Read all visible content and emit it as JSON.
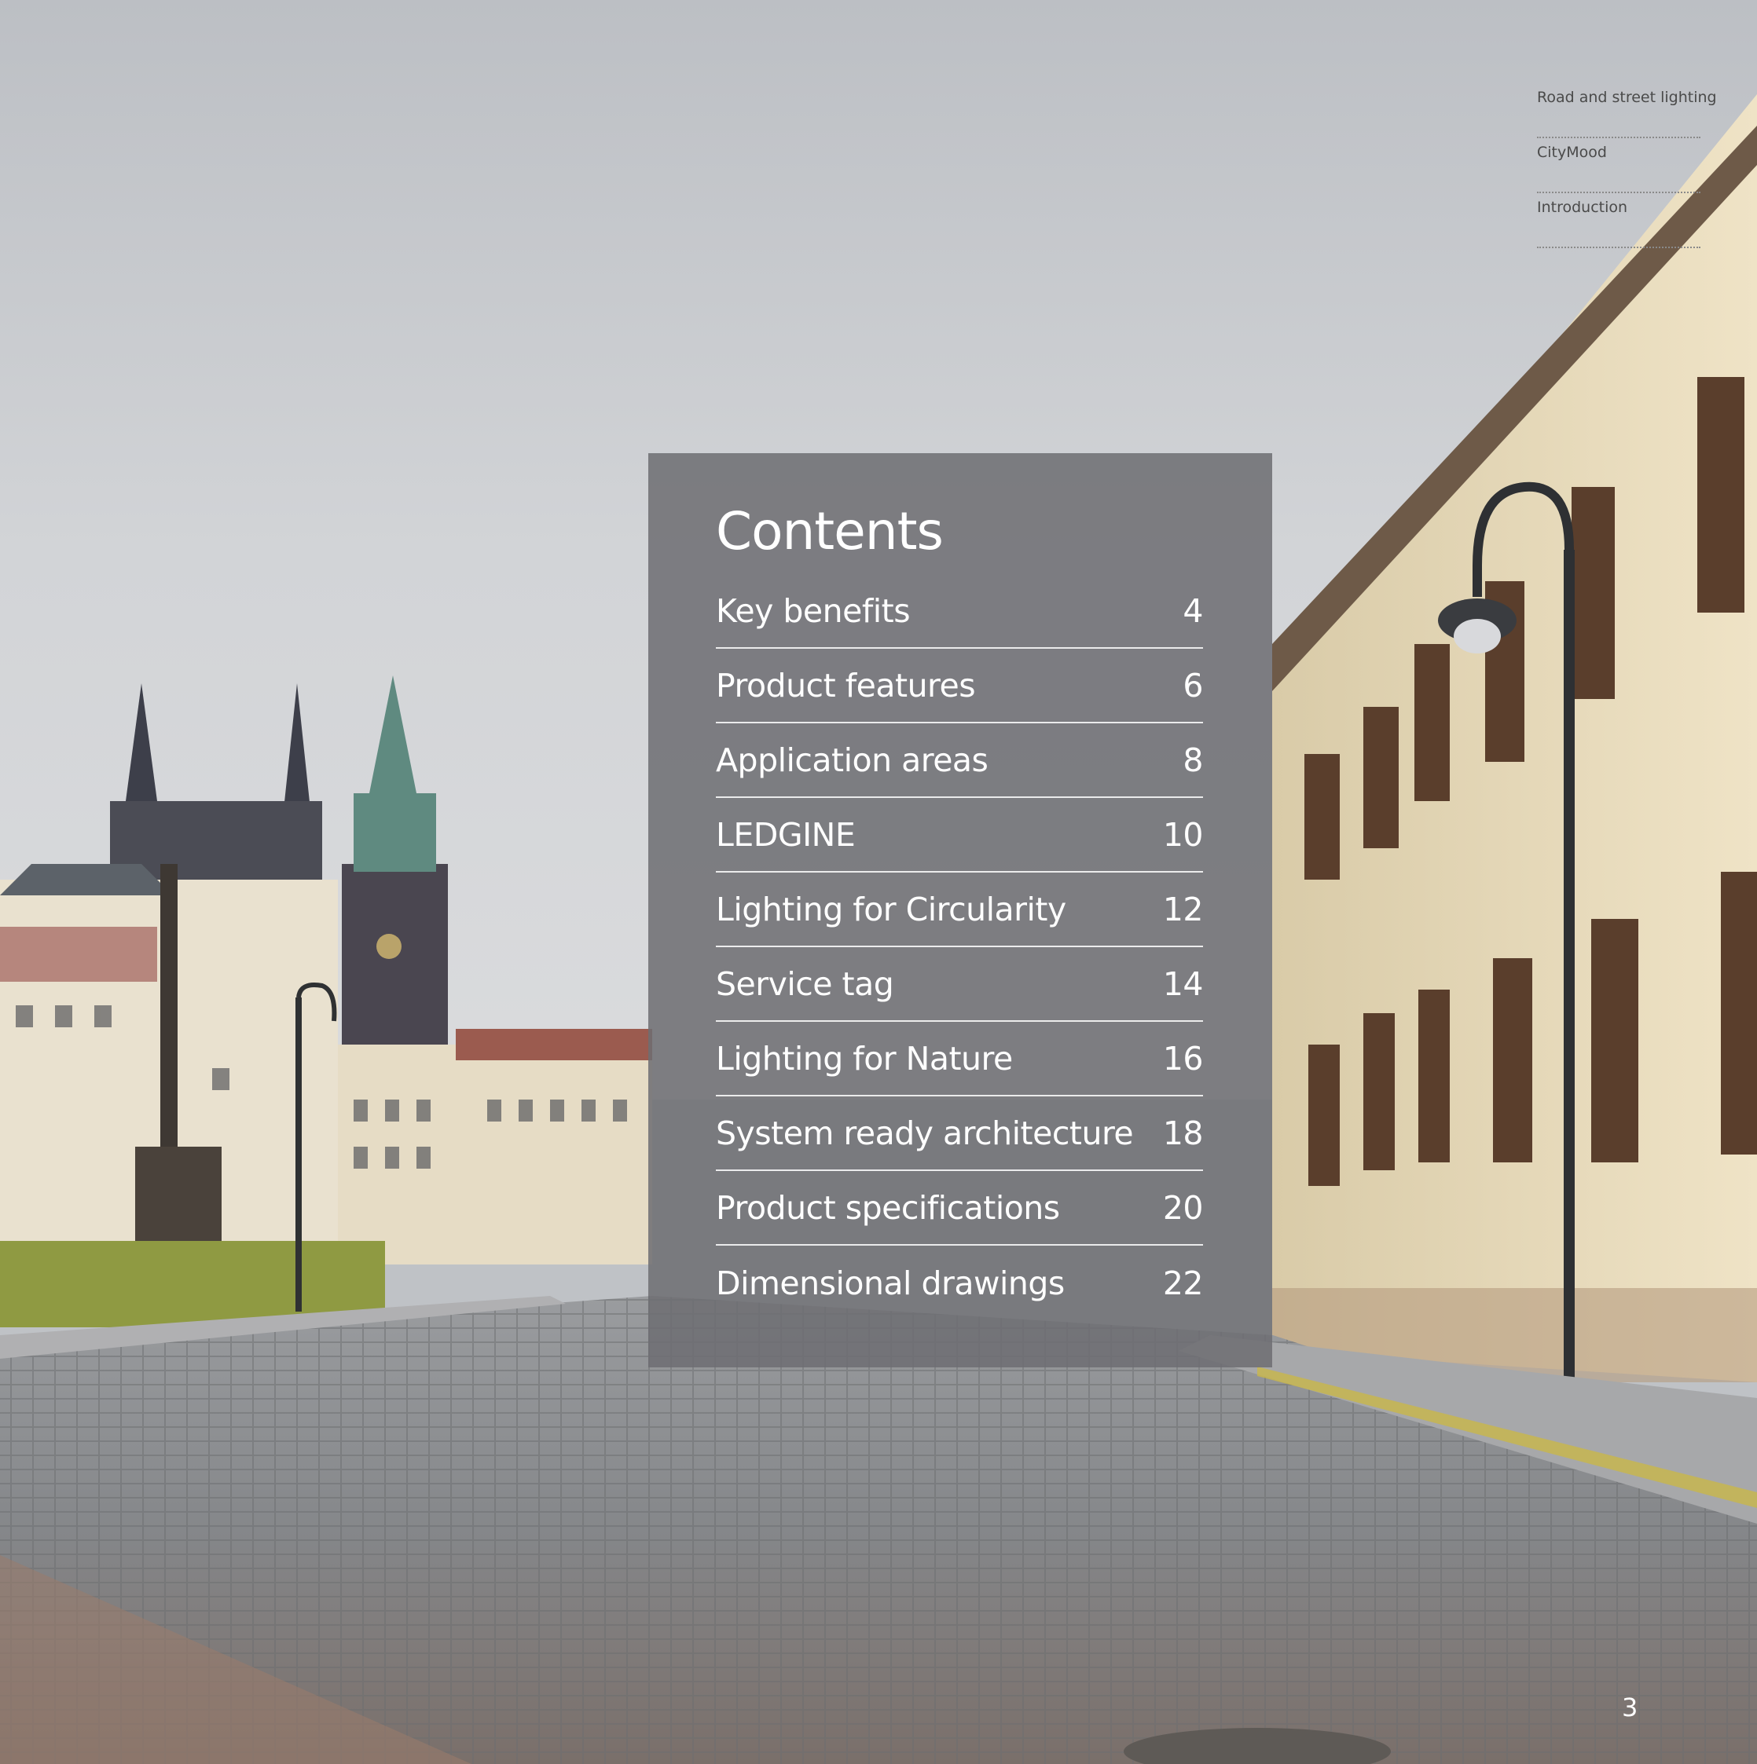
{
  "breadcrumb": {
    "items": [
      {
        "label": "Road and street lighting"
      },
      {
        "label": "CityMood"
      },
      {
        "label": "Introduction"
      }
    ]
  },
  "contents": {
    "title": "Contents",
    "items": [
      {
        "label": "Key benefits",
        "page": "4"
      },
      {
        "label": "Product features",
        "page": "6"
      },
      {
        "label": "Application areas",
        "page": "8"
      },
      {
        "label": "LEDGINE",
        "page": "10"
      },
      {
        "label": "Lighting for Circularity",
        "page": "12"
      },
      {
        "label": "Service tag",
        "page": "14"
      },
      {
        "label": "Lighting for Nature",
        "page": "16"
      },
      {
        "label": "System ready architecture",
        "page": "18"
      },
      {
        "label": "Product specifications",
        "page": "20"
      },
      {
        "label": "Dimensional drawings",
        "page": "22"
      }
    ]
  },
  "footer": {
    "page_number": "3"
  },
  "colors": {
    "panel": "#6e6e72",
    "sky": "#c9cbcf",
    "building": "#e8dcc0",
    "cobblestone": "#8a8c90"
  }
}
